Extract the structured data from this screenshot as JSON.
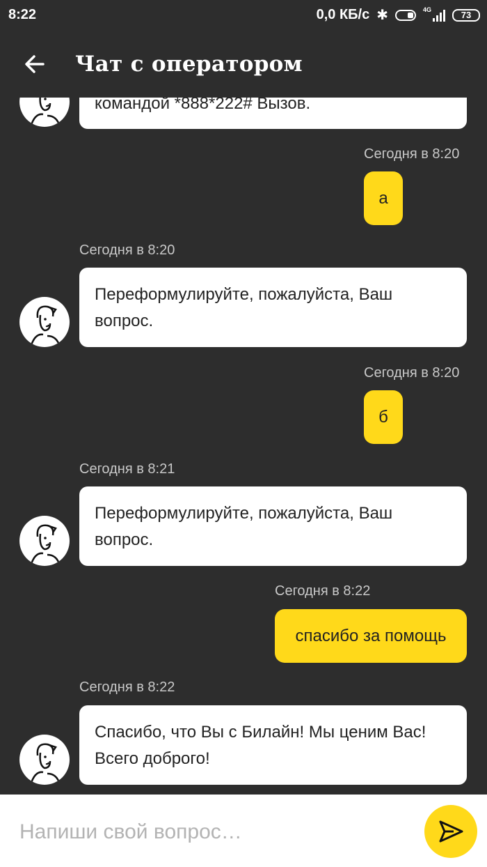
{
  "status_bar": {
    "time": "8:22",
    "net_speed": "0,0 КБ/с",
    "network_type": "4G",
    "battery": "73"
  },
  "header": {
    "back_icon": "arrow-left-icon",
    "title": "Чат с оператором"
  },
  "messages": [
    {
      "from": "operator",
      "time": "",
      "text": "командой *888*222# Вызов."
    },
    {
      "from": "user",
      "time": "Сегодня в 8:20",
      "text": "а"
    },
    {
      "from": "operator",
      "time": "Сегодня в 8:20",
      "text": "Переформулируйте, пожалуйста, Ваш вопрос."
    },
    {
      "from": "user",
      "time": "Сегодня в 8:20",
      "text": "б"
    },
    {
      "from": "operator",
      "time": "Сегодня в 8:21",
      "text": "Переформулируйте, пожалуйста, Ваш вопрос."
    },
    {
      "from": "user",
      "time": "Сегодня в 8:22",
      "text": "спасибо за помощь"
    },
    {
      "from": "operator",
      "time": "Сегодня в 8:22",
      "text": "Спасибо, что Вы с Билайн! Мы ценим Вас! Всего доброго!"
    }
  ],
  "composer": {
    "placeholder": "Напиши свой вопрос…",
    "value": "",
    "send_icon": "send-icon"
  },
  "colors": {
    "background": "#2d2d2d",
    "accent": "#ffd91a",
    "operator_bubble": "#ffffff"
  }
}
